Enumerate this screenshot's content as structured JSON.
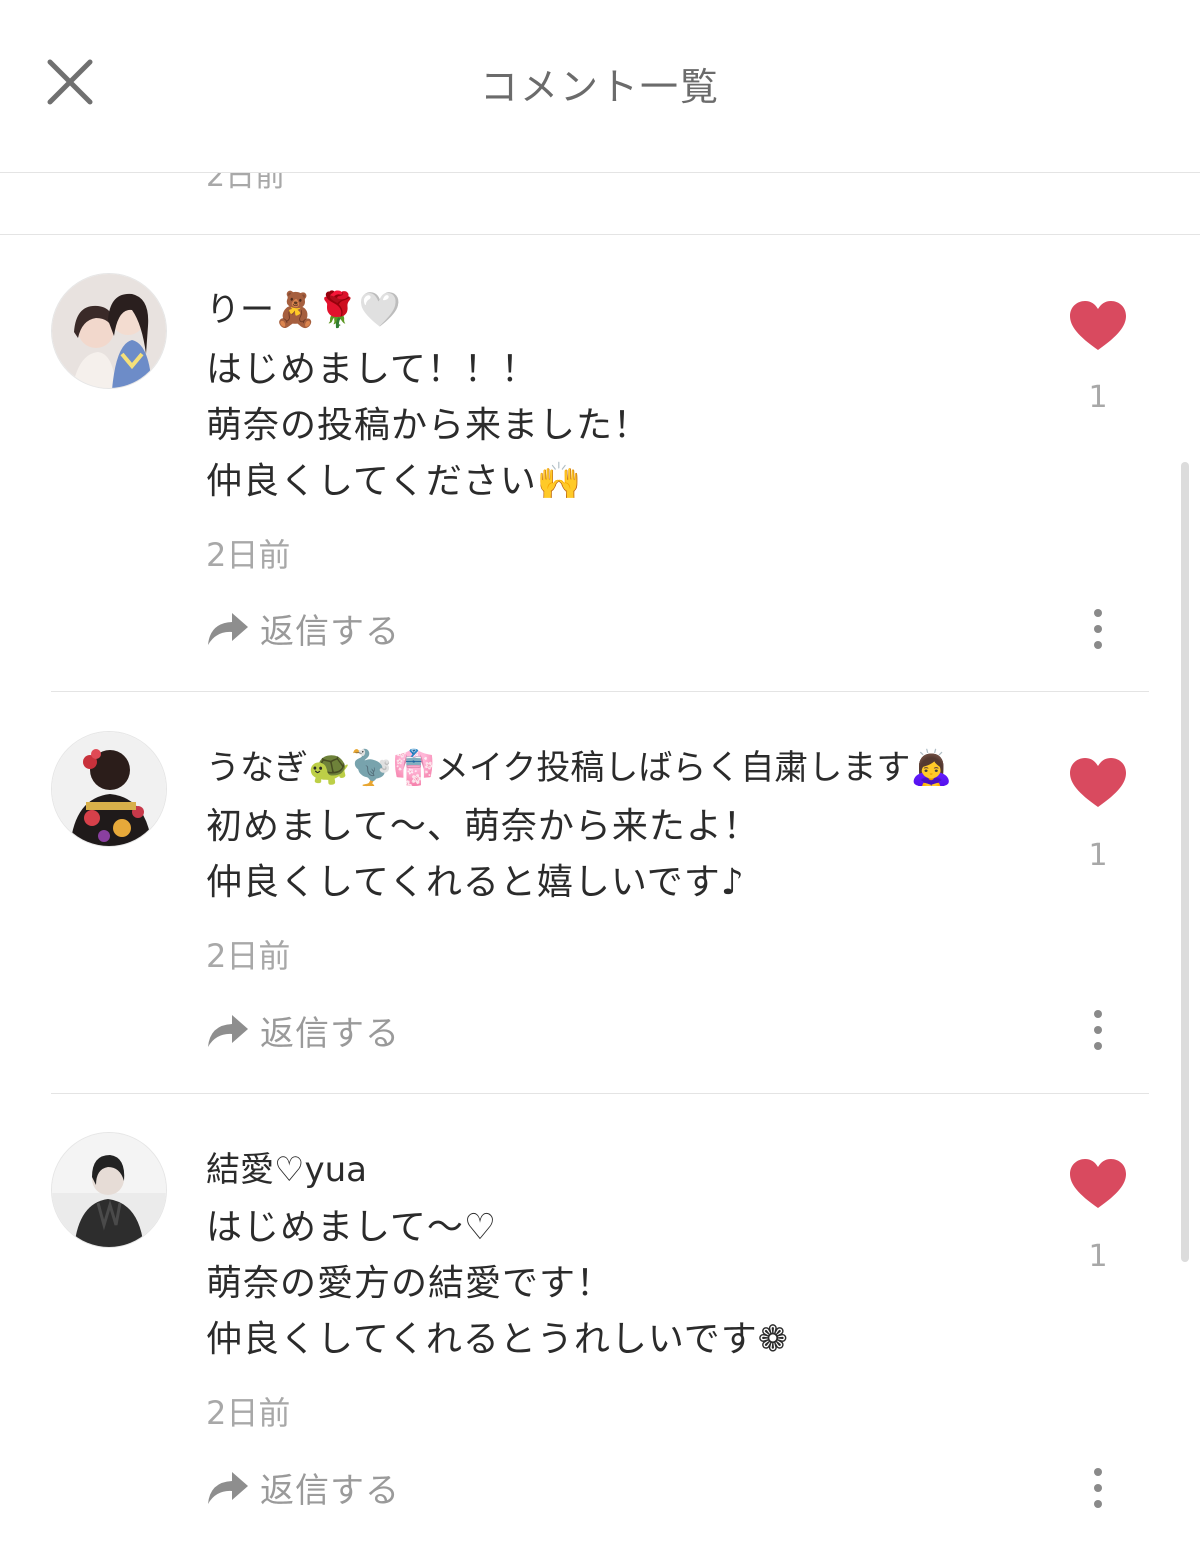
{
  "header": {
    "title": "コメント一覧",
    "close_icon": "close-icon"
  },
  "previous_comment": {
    "time": "2日前"
  },
  "colors": {
    "like": "#d94a5f",
    "muted": "#a8a8a8",
    "text": "#2b2b2b"
  },
  "comments": [
    {
      "name": "りー🧸🌹🤍",
      "lines": [
        "はじめまして！！！",
        "萌奈の投稿から来ました！",
        "仲良くしてください🙌"
      ],
      "time": "2日前",
      "reply_label": "返信する",
      "likes": "1"
    },
    {
      "name": "うなぎ🐢🦤👘メイク投稿しばらく自粛します🙇‍♀️",
      "lines": [
        "初めまして〜、萌奈から来たよ！",
        "仲良くしてくれると嬉しいです♪"
      ],
      "time": "2日前",
      "reply_label": "返信する",
      "likes": "1"
    },
    {
      "name": "結愛♡yua",
      "lines": [
        "はじめまして〜♡",
        "萌奈の愛方の結愛です！",
        "仲良くしてくれるとうれしいです❁"
      ],
      "time": "2日前",
      "reply_label": "返信する",
      "likes": "1"
    }
  ]
}
